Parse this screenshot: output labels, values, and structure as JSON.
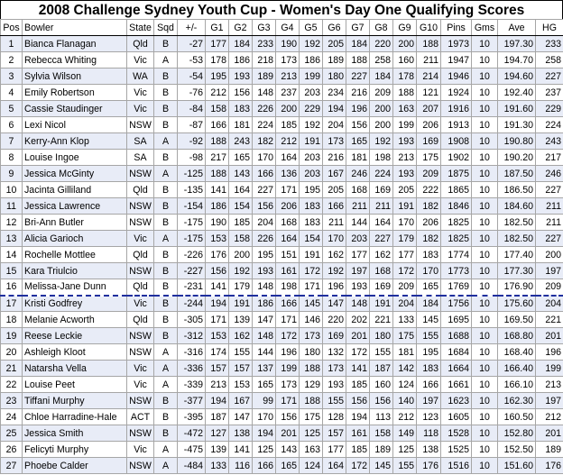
{
  "title": "2008 Challenge Sydney Youth Cup - Women's Day One Qualifying Scores",
  "cutoff_after_row": 16,
  "columns": [
    "Pos",
    "Bowler",
    "State",
    "Sqd",
    "+/-",
    "G1",
    "G2",
    "G3",
    "G4",
    "G5",
    "G6",
    "G7",
    "G8",
    "G9",
    "G10",
    "Pins",
    "Gms",
    "Ave",
    "HG"
  ],
  "rows": [
    [
      "1",
      "Bianca Flanagan",
      "Qld",
      "B",
      "-27",
      "177",
      "184",
      "233",
      "190",
      "192",
      "205",
      "184",
      "220",
      "200",
      "188",
      "1973",
      "10",
      "197.30",
      "233"
    ],
    [
      "2",
      "Rebecca Whiting",
      "Vic",
      "A",
      "-53",
      "178",
      "186",
      "218",
      "173",
      "186",
      "189",
      "188",
      "258",
      "160",
      "211",
      "1947",
      "10",
      "194.70",
      "258"
    ],
    [
      "3",
      "Sylvia Wilson",
      "WA",
      "B",
      "-54",
      "195",
      "193",
      "189",
      "213",
      "199",
      "180",
      "227",
      "184",
      "178",
      "214",
      "1946",
      "10",
      "194.60",
      "227"
    ],
    [
      "4",
      "Emily Robertson",
      "Vic",
      "B",
      "-76",
      "212",
      "156",
      "148",
      "237",
      "203",
      "234",
      "216",
      "209",
      "188",
      "121",
      "1924",
      "10",
      "192.40",
      "237"
    ],
    [
      "5",
      "Cassie Staudinger",
      "Vic",
      "B",
      "-84",
      "158",
      "183",
      "226",
      "200",
      "229",
      "194",
      "196",
      "200",
      "163",
      "207",
      "1916",
      "10",
      "191.60",
      "229"
    ],
    [
      "6",
      "Lexi Nicol",
      "NSW",
      "B",
      "-87",
      "166",
      "181",
      "224",
      "185",
      "192",
      "204",
      "156",
      "200",
      "199",
      "206",
      "1913",
      "10",
      "191.30",
      "224"
    ],
    [
      "7",
      "Kerry-Ann Klop",
      "SA",
      "A",
      "-92",
      "188",
      "243",
      "182",
      "212",
      "191",
      "173",
      "165",
      "192",
      "193",
      "169",
      "1908",
      "10",
      "190.80",
      "243"
    ],
    [
      "8",
      "Louise Ingoe",
      "SA",
      "B",
      "-98",
      "217",
      "165",
      "170",
      "164",
      "203",
      "216",
      "181",
      "198",
      "213",
      "175",
      "1902",
      "10",
      "190.20",
      "217"
    ],
    [
      "9",
      "Jessica McGinty",
      "NSW",
      "A",
      "-125",
      "188",
      "143",
      "166",
      "136",
      "203",
      "167",
      "246",
      "224",
      "193",
      "209",
      "1875",
      "10",
      "187.50",
      "246"
    ],
    [
      "10",
      "Jacinta Gilliland",
      "Qld",
      "B",
      "-135",
      "141",
      "164",
      "227",
      "171",
      "195",
      "205",
      "168",
      "169",
      "205",
      "222",
      "1865",
      "10",
      "186.50",
      "227"
    ],
    [
      "11",
      "Jessica Lawrence",
      "NSW",
      "B",
      "-154",
      "186",
      "154",
      "156",
      "206",
      "183",
      "166",
      "211",
      "211",
      "191",
      "182",
      "1846",
      "10",
      "184.60",
      "211"
    ],
    [
      "12",
      "Bri-Ann Butler",
      "NSW",
      "B",
      "-175",
      "190",
      "185",
      "204",
      "168",
      "183",
      "211",
      "144",
      "164",
      "170",
      "206",
      "1825",
      "10",
      "182.50",
      "211"
    ],
    [
      "13",
      "Alicia Garioch",
      "Vic",
      "A",
      "-175",
      "153",
      "158",
      "226",
      "164",
      "154",
      "170",
      "203",
      "227",
      "179",
      "182",
      "1825",
      "10",
      "182.50",
      "227"
    ],
    [
      "14",
      "Rochelle Mottlee",
      "Qld",
      "B",
      "-226",
      "176",
      "200",
      "195",
      "151",
      "191",
      "162",
      "177",
      "162",
      "177",
      "183",
      "1774",
      "10",
      "177.40",
      "200"
    ],
    [
      "15",
      "Kara Triulcio",
      "NSW",
      "B",
      "-227",
      "156",
      "192",
      "193",
      "161",
      "172",
      "192",
      "197",
      "168",
      "172",
      "170",
      "1773",
      "10",
      "177.30",
      "197"
    ],
    [
      "16",
      "Melissa-Jane Dunn",
      "Qld",
      "B",
      "-231",
      "141",
      "179",
      "148",
      "198",
      "171",
      "196",
      "193",
      "169",
      "209",
      "165",
      "1769",
      "10",
      "176.90",
      "209"
    ],
    [
      "17",
      "Kristi Godfrey",
      "Vic",
      "B",
      "-244",
      "194",
      "191",
      "186",
      "166",
      "145",
      "147",
      "148",
      "191",
      "204",
      "184",
      "1756",
      "10",
      "175.60",
      "204"
    ],
    [
      "18",
      "Melanie Acworth",
      "Qld",
      "B",
      "-305",
      "171",
      "139",
      "147",
      "171",
      "146",
      "220",
      "202",
      "221",
      "133",
      "145",
      "1695",
      "10",
      "169.50",
      "221"
    ],
    [
      "19",
      "Reese Leckie",
      "NSW",
      "B",
      "-312",
      "153",
      "162",
      "148",
      "172",
      "173",
      "169",
      "201",
      "180",
      "175",
      "155",
      "1688",
      "10",
      "168.80",
      "201"
    ],
    [
      "20",
      "Ashleigh Kloot",
      "NSW",
      "A",
      "-316",
      "174",
      "155",
      "144",
      "196",
      "180",
      "132",
      "172",
      "155",
      "181",
      "195",
      "1684",
      "10",
      "168.40",
      "196"
    ],
    [
      "21",
      "Natarsha Vella",
      "Vic",
      "A",
      "-336",
      "157",
      "157",
      "137",
      "199",
      "188",
      "173",
      "141",
      "187",
      "142",
      "183",
      "1664",
      "10",
      "166.40",
      "199"
    ],
    [
      "22",
      "Louise Peet",
      "Vic",
      "A",
      "-339",
      "213",
      "153",
      "165",
      "173",
      "129",
      "193",
      "185",
      "160",
      "124",
      "166",
      "1661",
      "10",
      "166.10",
      "213"
    ],
    [
      "23",
      "Tiffani Murphy",
      "NSW",
      "B",
      "-377",
      "194",
      "167",
      "99",
      "171",
      "188",
      "155",
      "156",
      "156",
      "140",
      "197",
      "1623",
      "10",
      "162.30",
      "197"
    ],
    [
      "24",
      "Chloe Harradine-Hale",
      "ACT",
      "B",
      "-395",
      "187",
      "147",
      "170",
      "156",
      "175",
      "128",
      "194",
      "113",
      "212",
      "123",
      "1605",
      "10",
      "160.50",
      "212"
    ],
    [
      "25",
      "Jessica Smith",
      "NSW",
      "B",
      "-472",
      "127",
      "138",
      "194",
      "201",
      "125",
      "157",
      "161",
      "158",
      "149",
      "118",
      "1528",
      "10",
      "152.80",
      "201"
    ],
    [
      "26",
      "Felicyti Murphy",
      "Vic",
      "A",
      "-475",
      "139",
      "141",
      "125",
      "143",
      "163",
      "177",
      "185",
      "189",
      "125",
      "138",
      "1525",
      "10",
      "152.50",
      "189"
    ],
    [
      "27",
      "Phoebe Calder",
      "NSW",
      "A",
      "-484",
      "133",
      "116",
      "166",
      "165",
      "124",
      "164",
      "172",
      "145",
      "155",
      "176",
      "1516",
      "10",
      "151.60",
      "176"
    ]
  ]
}
